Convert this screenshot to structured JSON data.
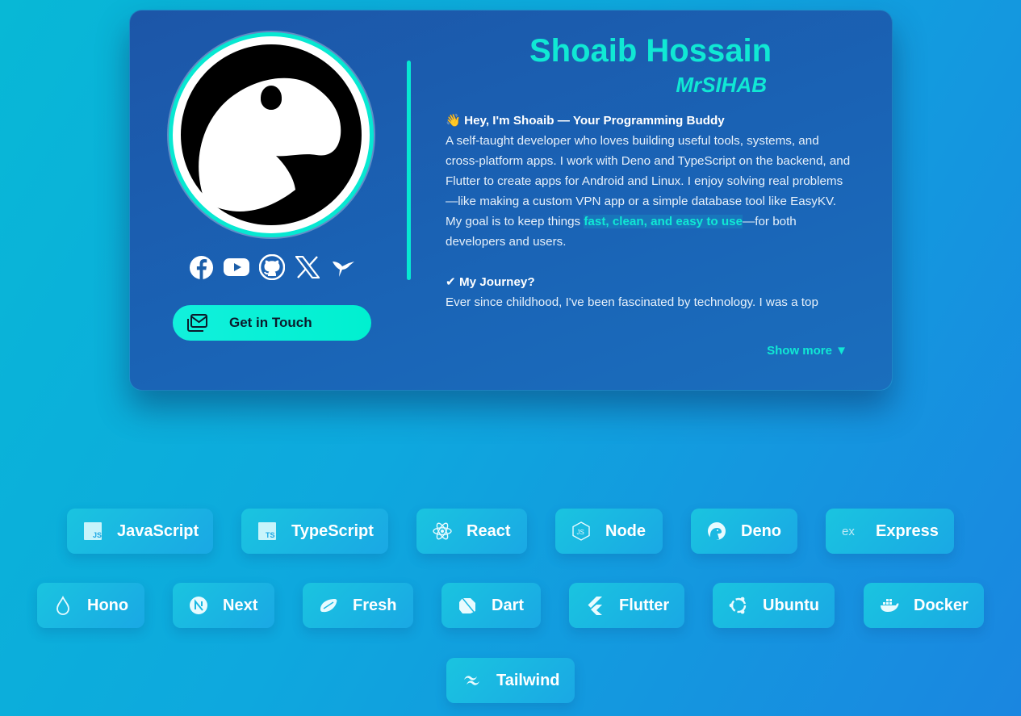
{
  "profile": {
    "name": "Shoaib Hossain",
    "handle": "MrSIHAB",
    "cta_label": "Get in Touch",
    "socials": [
      "facebook-icon",
      "youtube-icon",
      "github-icon",
      "x-icon",
      "hummingbird-icon"
    ]
  },
  "bio": {
    "intro_heading": "👋 Hey, I'm Shoaib — Your Programming Buddy",
    "intro_text": "A self-taught developer who loves building useful tools, systems, and cross-platform apps. I work with Deno and TypeScript on the backend, and Flutter to create apps for Android and Linux. I enjoy solving real problems—like making a custom VPN app or a simple database tool like EasyKV.",
    "goal_prefix": "My goal is to keep things ",
    "goal_highlight": "fast, clean, and easy to use",
    "goal_suffix": "—for both developers and users.",
    "journey_heading": "✔ My Journey?",
    "journey_text": "Ever since childhood, I've been fascinated by technology. I was a top",
    "show_more": "Show more ▼"
  },
  "technologies": [
    {
      "label": "JavaScript",
      "icon": "javascript-icon"
    },
    {
      "label": "TypeScript",
      "icon": "typescript-icon"
    },
    {
      "label": "React",
      "icon": "react-icon"
    },
    {
      "label": "Node",
      "icon": "node-icon"
    },
    {
      "label": "Deno",
      "icon": "deno-icon"
    },
    {
      "label": "Express",
      "icon": "express-icon"
    },
    {
      "label": "Hono",
      "icon": "hono-icon"
    },
    {
      "label": "Next",
      "icon": "next-icon"
    },
    {
      "label": "Fresh",
      "icon": "fresh-icon"
    },
    {
      "label": "Dart",
      "icon": "dart-icon"
    },
    {
      "label": "Flutter",
      "icon": "flutter-icon"
    },
    {
      "label": "Ubuntu",
      "icon": "ubuntu-icon"
    },
    {
      "label": "Docker",
      "icon": "docker-icon"
    },
    {
      "label": "Tailwind",
      "icon": "tailwind-icon"
    }
  ],
  "colors": {
    "accent": "#10e8d4",
    "card": "#1c5ea8",
    "chip": "#1ab8e2"
  }
}
